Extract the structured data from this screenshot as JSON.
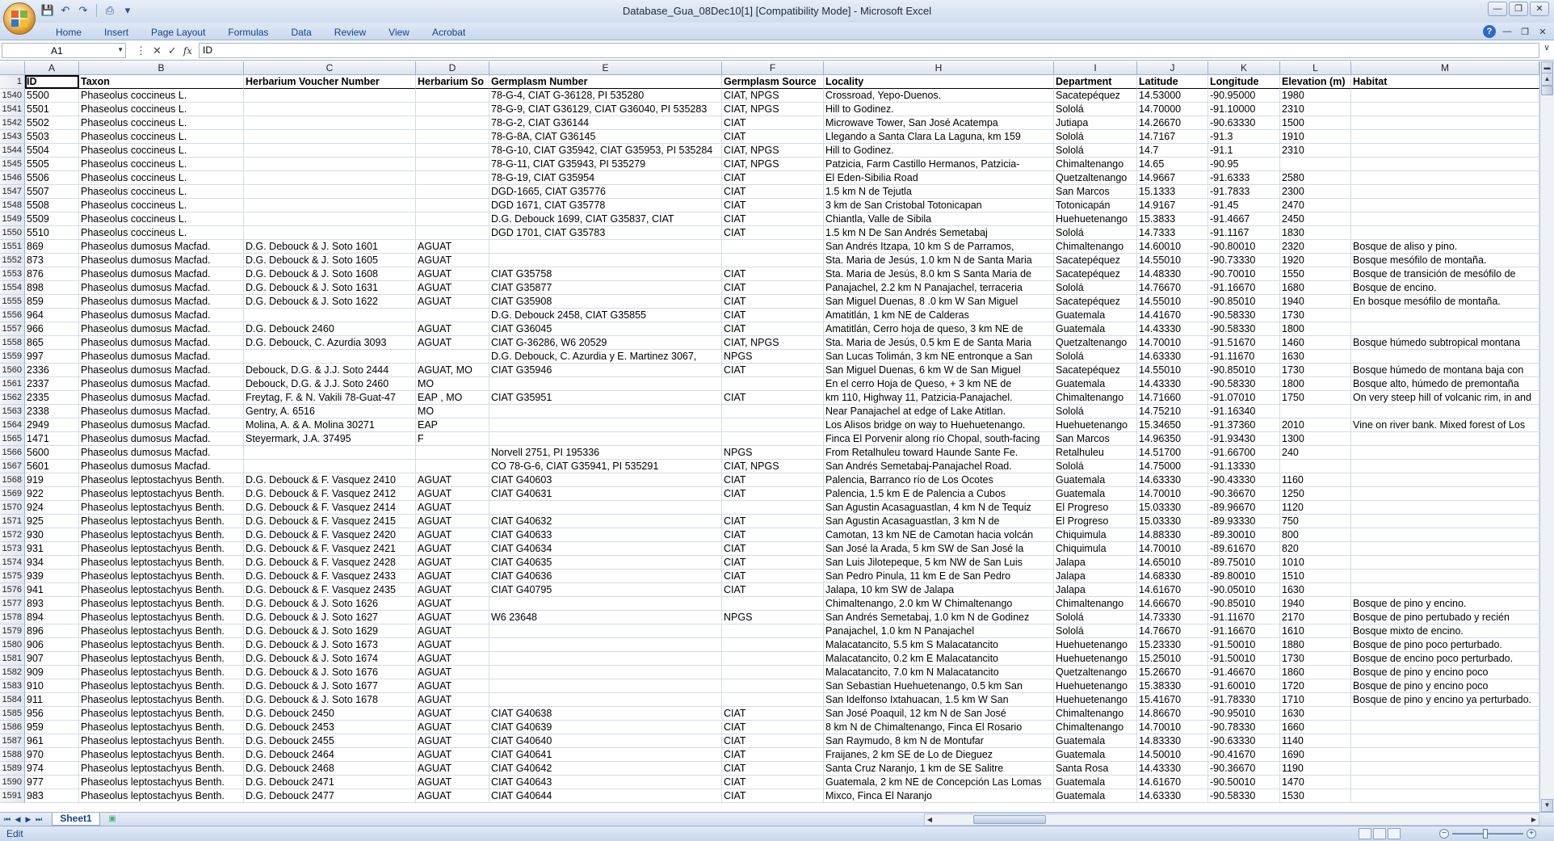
{
  "window": {
    "title": "Database_Gua_08Dec10[1]  [Compatibility Mode] - Microsoft Excel"
  },
  "ribbon": {
    "tabs": [
      "Home",
      "Insert",
      "Page Layout",
      "Formulas",
      "Data",
      "Review",
      "View",
      "Acrobat"
    ]
  },
  "formula_bar": {
    "name_box": "A1",
    "formula": "ID"
  },
  "columns": [
    {
      "letter": "A",
      "w": 67
    },
    {
      "letter": "B",
      "w": 204
    },
    {
      "letter": "C",
      "w": 213
    },
    {
      "letter": "D",
      "w": 91
    },
    {
      "letter": "E",
      "w": 288
    },
    {
      "letter": "F",
      "w": 126
    },
    {
      "letter": "H",
      "w": 285
    },
    {
      "letter": "I",
      "w": 103
    },
    {
      "letter": "J",
      "w": 88
    },
    {
      "letter": "K",
      "w": 89
    },
    {
      "letter": "L",
      "w": 88
    },
    {
      "letter": "M",
      "w": 233
    }
  ],
  "header_row": {
    "row_num": "1",
    "cells": [
      "ID",
      "Taxon",
      "Herbarium Voucher Number",
      "Herbarium So",
      "Germplasm Number",
      "Germplasm Source",
      "Locality",
      "Department",
      "Latitude",
      "Longitude",
      "Elevation (m)",
      "Habitat"
    ]
  },
  "rows": [
    [
      "1540",
      "5500",
      "Phaseolus coccineus L.",
      "",
      "",
      "78-G-4, CIAT G-36128, PI 535280",
      "CIAT, NPGS",
      "Crossroad, Yepo-Duenos.",
      "Sacatepéquez",
      "14.53000",
      "-90.95000",
      "1980",
      ""
    ],
    [
      "1541",
      "5501",
      "Phaseolus coccineus L.",
      "",
      "",
      "78-G-9, CIAT G36129, CIAT G36040, PI 535283",
      "CIAT, NPGS",
      "Hill to Godinez.",
      "Sololá",
      "14.70000",
      "-91.10000",
      "2310",
      ""
    ],
    [
      "1542",
      "5502",
      "Phaseolus coccineus L.",
      "",
      "",
      "78-G-2, CIAT G36144",
      "CIAT",
      "Microwave Tower, San José Acatempa",
      "Jutiapa",
      "14.26670",
      "-90.63330",
      "1500",
      ""
    ],
    [
      "1543",
      "5503",
      "Phaseolus coccineus L.",
      "",
      "",
      "78-G-8A, CIAT G36145",
      "CIAT",
      "Llegando a Santa Clara La Laguna, km 159",
      "Sololá",
      "14.7167",
      "-91.3",
      "1910",
      ""
    ],
    [
      "1544",
      "5504",
      "Phaseolus coccineus L.",
      "",
      "",
      "78-G-10, CIAT G35942, CIAT G35953, PI 535284",
      "CIAT, NPGS",
      "Hill to Godinez.",
      "Sololá",
      "14.7",
      "-91.1",
      "2310",
      ""
    ],
    [
      "1545",
      "5505",
      "Phaseolus coccineus L.",
      "",
      "",
      "78-G-11, CIAT G35943, PI 535279",
      "CIAT, NPGS",
      "Patzicia, Farm Castillo Hermanos, Patzicia-",
      "Chimaltenango",
      "14.65",
      "-90.95",
      "",
      ""
    ],
    [
      "1546",
      "5506",
      "Phaseolus coccineus L.",
      "",
      "",
      "78-G-19, CIAT G35954",
      "CIAT",
      "El Eden-Sibilia Road",
      "Quetzaltenango",
      "14.9667",
      "-91.6333",
      "2580",
      ""
    ],
    [
      "1547",
      "5507",
      "Phaseolus coccineus L.",
      "",
      "",
      "DGD-1665, CIAT G35776",
      "CIAT",
      "1.5 km N de Tejutla",
      "San Marcos",
      "15.1333",
      "-91.7833",
      "2300",
      ""
    ],
    [
      "1548",
      "5508",
      "Phaseolus coccineus L.",
      "",
      "",
      "DGD 1671, CIAT G35778",
      "CIAT",
      "3 km de San Cristobal Totonicapan",
      "Totonicapán",
      "14.9167",
      "-91.45",
      "2470",
      ""
    ],
    [
      "1549",
      "5509",
      "Phaseolus coccineus L.",
      "",
      "",
      "D.G. Debouck 1699, CIAT G35837, CIAT",
      "CIAT",
      "Chiantla, Valle de Sibila",
      "Huehuetenango",
      "15.3833",
      "-91.4667",
      "2450",
      ""
    ],
    [
      "1550",
      "5510",
      "Phaseolus coccineus L.",
      "",
      "",
      "DGD 1701, CIAT G35783",
      "CIAT",
      "1.5 km N De San Andrés Semetabaj",
      "Sololá",
      "14.7333",
      "-91.1167",
      "1830",
      ""
    ],
    [
      "1551",
      "869",
      "Phaseolus dumosus Macfad.",
      "D.G. Debouck & J. Soto 1601",
      "AGUAT",
      "",
      "",
      "San Andrés Itzapa, 10 km S de Parramos,",
      "Chimaltenango",
      "14.60010",
      "-90.80010",
      "2320",
      "Bosque de aliso y pino."
    ],
    [
      "1552",
      "873",
      "Phaseolus dumosus Macfad.",
      "D.G. Debouck & J. Soto 1605",
      "AGUAT",
      "",
      "",
      "Sta. Maria de Jesús, 1.0 km N de Santa Maria",
      "Sacatepéquez",
      "14.55010",
      "-90.73330",
      "1920",
      "Bosque mesófilo de montaña."
    ],
    [
      "1553",
      "876",
      "Phaseolus dumosus Macfad.",
      "D.G. Debouck & J. Soto 1608",
      "AGUAT",
      "CIAT G35758",
      "CIAT",
      "Sta. Maria de Jesús, 8.0 km S Santa Maria de",
      "Sacatepéquez",
      "14.48330",
      "-90.70010",
      "1550",
      "Bosque de transición de mesófilo de"
    ],
    [
      "1554",
      "898",
      "Phaseolus dumosus Macfad.",
      "D.G. Debouck & J. Soto 1631",
      "AGUAT",
      "CIAT G35877",
      "CIAT",
      "Panajachel, 2.2 km N Panajachel, terraceria",
      "Sololá",
      "14.76670",
      "-91.16670",
      "1680",
      "Bosque de encino."
    ],
    [
      "1555",
      "859",
      "Phaseolus dumosus Macfad.",
      "D.G. Debouck & J. Soto 1622",
      "AGUAT",
      "CIAT G35908",
      "CIAT",
      "San Miguel Duenas, 8 .0 km W San Miguel",
      "Sacatepéquez",
      "14.55010",
      "-90.85010",
      "1940",
      "En bosque mesófilo de montaña."
    ],
    [
      "1556",
      "964",
      "Phaseolus dumosus Macfad.",
      "",
      "",
      "D.G. Debouck 2458, CIAT G35855",
      "CIAT",
      "Amatitlán, 1 km NE de Calderas",
      "Guatemala",
      "14.41670",
      "-90.58330",
      "1730",
      ""
    ],
    [
      "1557",
      "966",
      "Phaseolus dumosus Macfad.",
      "D.G. Debouck 2460",
      "AGUAT",
      "CIAT G36045",
      "CIAT",
      "Amatitlán, Cerro hoja de queso, 3 km NE de",
      "Guatemala",
      "14.43330",
      "-90.58330",
      "1800",
      ""
    ],
    [
      "1558",
      "865",
      "Phaseolus dumosus Macfad.",
      "D.G. Debouck, C. Azurdia 3093",
      "AGUAT",
      "CIAT G-36286, W6 20529",
      "CIAT, NPGS",
      "Sta. Maria de Jesús, 0.5 km E de Santa Maria",
      "Quetzaltenango",
      "14.70010",
      "-91.51670",
      "1460",
      "Bosque húmedo subtropical montana"
    ],
    [
      "1559",
      "997",
      "Phaseolus dumosus Macfad.",
      "",
      "",
      "D.G. Debouck, C. Azurdia y E. Martinez 3067,",
      "NPGS",
      "San Lucas Tolimán, 3 km NE entronque a San",
      "Sololá",
      "14.63330",
      "-91.11670",
      "1630",
      ""
    ],
    [
      "1560",
      "2336",
      "Phaseolus dumosus Macfad.",
      "Debouck, D.G. & J.J. Soto  2444",
      "AGUAT, MO",
      "CIAT G35946",
      "CIAT",
      "San Miguel Duenas, 6 km W de San Miguel",
      "Sacatepéquez",
      "14.55010",
      "-90.85010",
      "1730",
      "Bosque húmedo de montana baja con"
    ],
    [
      "1561",
      "2337",
      "Phaseolus dumosus Macfad.",
      "Debouck, D.G. & J.J. Soto  2460",
      "MO",
      "",
      "",
      "En el cerro Hoja de Queso, + 3 km NE de",
      "Guatemala",
      "14.43330",
      "-90.58330",
      "1800",
      "Bosque alto, húmedo de premontaña"
    ],
    [
      "1562",
      "2335",
      "Phaseolus dumosus Macfad.",
      "Freytag, F. & N. Vakili 78-Guat-47",
      "EAP , MO",
      "CIAT G35951",
      "CIAT",
      "km 110, Highway 11, Patzicia-Panajachel.",
      "Chimaltenango",
      "14.71660",
      "-91.07010",
      "1750",
      "On very steep  hill of volcanic rim, in and"
    ],
    [
      "1563",
      "2338",
      "Phaseolus dumosus Macfad.",
      "Gentry, A.  6516",
      "MO",
      "",
      "",
      "Near Panajachel at edge of Lake Atitlan.",
      "Sololá",
      "14.75210",
      "-91.16340",
      "",
      ""
    ],
    [
      "1564",
      "2949",
      "Phaseolus dumosus Macfad.",
      "Molina, A. & A. Molina  30271",
      "EAP",
      "",
      "",
      "Los Alisos bridge on way to Huehuetenango.",
      "Huehuetenango",
      "15.34650",
      "-91.37360",
      "2010",
      "Vine on river bank. Mixed forest of Los"
    ],
    [
      "1565",
      "1471",
      "Phaseolus dumosus Macfad.",
      "Steyermark, J.A.  37495",
      "F",
      "",
      "",
      "Finca El Porvenir along río Chopal, south-facing",
      "San Marcos",
      "14.96350",
      "-91.93430",
      "1300",
      ""
    ],
    [
      "1566",
      "5600",
      "Phaseolus dumosus Macfad.",
      "",
      "",
      "Norvell 2751, PI 195336",
      "NPGS",
      "From Retalhuleu toward Haunde Sante Fe.",
      "Retalhuleu",
      "14.51700",
      "-91.66700",
      "240",
      ""
    ],
    [
      "1567",
      "5601",
      "Phaseolus dumosus Macfad.",
      "",
      "",
      "CO 78-G-6, CIAT G35941, PI 535291",
      "CIAT, NPGS",
      "San Andrés Semetabaj-Panajachel Road.",
      "Sololá",
      "14.75000",
      "-91.13330",
      "",
      ""
    ],
    [
      "1568",
      "919",
      "Phaseolus leptostachyus Benth.",
      "D.G. Debouck & F. Vasquez 2410",
      "AGUAT",
      "CIAT G40603",
      "CIAT",
      "Palencia, Barranco río de Los Ocotes",
      "Guatemala",
      "14.63330",
      "-90.43330",
      "1160",
      ""
    ],
    [
      "1569",
      "922",
      "Phaseolus leptostachyus Benth.",
      "D.G. Debouck & F. Vasquez 2412",
      "AGUAT",
      "CIAT G40631",
      "CIAT",
      "Palencia, 1.5 km E de Palencia a Cubos",
      "Guatemala",
      "14.70010",
      "-90.36670",
      "1250",
      ""
    ],
    [
      "1570",
      "924",
      "Phaseolus leptostachyus Benth.",
      "D.G. Debouck & F. Vasquez 2414",
      "AGUAT",
      "",
      "",
      "San Agustin Acasaguastlan, 4 km N de Tequiz",
      "El Progreso",
      "15.03330",
      "-89.96670",
      "1120",
      ""
    ],
    [
      "1571",
      "925",
      "Phaseolus leptostachyus Benth.",
      "D.G. Debouck & F. Vasquez 2415",
      "AGUAT",
      "CIAT G40632",
      "CIAT",
      "San Agustin Acasaguastlan, 3 km N de",
      "El Progreso",
      "15.03330",
      "-89.93330",
      "750",
      ""
    ],
    [
      "1572",
      "930",
      "Phaseolus leptostachyus Benth.",
      "D.G. Debouck & F. Vasquez 2420",
      "AGUAT",
      "CIAT G40633",
      "CIAT",
      "Camotan, 13 km NE de Camotan hacia volcán",
      "Chiquimula",
      "14.88330",
      "-89.30010",
      "800",
      ""
    ],
    [
      "1573",
      "931",
      "Phaseolus leptostachyus Benth.",
      "D.G. Debouck & F. Vasquez 2421",
      "AGUAT",
      "CIAT G40634",
      "CIAT",
      "San José la Arada, 5 km SW de San José la",
      "Chiquimula",
      "14.70010",
      "-89.61670",
      "820",
      ""
    ],
    [
      "1574",
      "934",
      "Phaseolus leptostachyus Benth.",
      "D.G. Debouck & F. Vasquez 2428",
      "AGUAT",
      "CIAT G40635",
      "CIAT",
      "San Luis Jilotepeque, 5 km NW de San Luis",
      "Jalapa",
      "14.65010",
      "-89.75010",
      "1010",
      ""
    ],
    [
      "1575",
      "939",
      "Phaseolus leptostachyus Benth.",
      "D.G. Debouck & F. Vasquez 2433",
      "AGUAT",
      "CIAT G40636",
      "CIAT",
      "San Pedro Pinula, 11 km E de San Pedro",
      "Jalapa",
      "14.68330",
      "-89.80010",
      "1510",
      ""
    ],
    [
      "1576",
      "941",
      "Phaseolus leptostachyus Benth.",
      "D.G. Debouck & F. Vasquez 2435",
      "AGUAT",
      "CIAT G40795",
      "CIAT",
      "Jalapa, 10 km SW de Jalapa",
      "Jalapa",
      "14.61670",
      "-90.05010",
      "1630",
      ""
    ],
    [
      "1577",
      "893",
      "Phaseolus leptostachyus Benth.",
      "D.G. Debouck & J. Soto 1626",
      "AGUAT",
      "",
      "",
      "Chimaltenango, 2.0 km W Chimaltenango",
      "Chimaltenango",
      "14.66670",
      "-90.85010",
      "1940",
      "Bosque de pino y encino."
    ],
    [
      "1578",
      "894",
      "Phaseolus leptostachyus Benth.",
      "D.G. Debouck & J. Soto 1627",
      "AGUAT",
      "W6 23648",
      "NPGS",
      "San Andrés Semetabaj, 1.0 km N de Godinez",
      "Sololá",
      "14.73330",
      "-91.11670",
      "2170",
      "Bosque de pino pertubado y recién"
    ],
    [
      "1579",
      "896",
      "Phaseolus leptostachyus Benth.",
      "D.G. Debouck & J. Soto 1629",
      "AGUAT",
      "",
      "",
      "Panajachel, 1.0 km N Panajachel",
      "Sololá",
      "14.76670",
      "-91.16670",
      "1610",
      "Bosque mixto de encino."
    ],
    [
      "1580",
      "906",
      "Phaseolus leptostachyus Benth.",
      "D.G. Debouck & J. Soto 1673",
      "AGUAT",
      "",
      "",
      "Malacatancito, 5.5 km S Malacatancito",
      "Huehuetenango",
      "15.23330",
      "-91.50010",
      "1880",
      "Bosque de pino poco perturbado."
    ],
    [
      "1581",
      "907",
      "Phaseolus leptostachyus Benth.",
      "D.G. Debouck & J. Soto 1674",
      "AGUAT",
      "",
      "",
      "Malacatancito, 0.2 km E Malacatancito",
      "Huehuetenango",
      "15.25010",
      "-91.50010",
      "1730",
      "Bosque de encino poco perturbado."
    ],
    [
      "1582",
      "909",
      "Phaseolus leptostachyus Benth.",
      "D.G. Debouck & J. Soto 1676",
      "AGUAT",
      "",
      "",
      "Malacatancito, 7.0 km N Malacatancito",
      "Quetzaltenango",
      "15.26670",
      "-91.46670",
      "1860",
      "Bosque de pino y encino poco"
    ],
    [
      "1583",
      "910",
      "Phaseolus leptostachyus Benth.",
      "D.G. Debouck & J. Soto 1677",
      "AGUAT",
      "",
      "",
      "San Sebastian Huehuetenango, 0.5 km San",
      "Huehuetenango",
      "15.38330",
      "-91.60010",
      "1720",
      "Bosque de pino y encino poco"
    ],
    [
      "1584",
      "911",
      "Phaseolus leptostachyus Benth.",
      "D.G. Debouck & J. Soto 1678",
      "AGUAT",
      "",
      "",
      "San Idelfonso Ixtahuacan, 1.5 km W San",
      "Huehuetenango",
      "15.41670",
      "-91.78330",
      "1710",
      "Bosque de pino y encino ya perturbado."
    ],
    [
      "1585",
      "956",
      "Phaseolus leptostachyus Benth.",
      "D.G. Debouck 2450",
      "AGUAT",
      "CIAT G40638",
      "CIAT",
      "San José Poaquil, 12 km N de San José",
      "Chimaltenango",
      "14.86670",
      "-90.95010",
      "1630",
      ""
    ],
    [
      "1586",
      "959",
      "Phaseolus leptostachyus Benth.",
      "D.G. Debouck 2453",
      "AGUAT",
      "CIAT G40639",
      "CIAT",
      "8 km N de Chimaltenango, Finca El Rosario",
      "Chimaltenango",
      "14.70010",
      "-90.78330",
      "1660",
      ""
    ],
    [
      "1587",
      "961",
      "Phaseolus leptostachyus Benth.",
      "D.G. Debouck 2455",
      "AGUAT",
      "CIAT G40640",
      "CIAT",
      "San Raymudo, 8 km N de Montufar",
      "Guatemala",
      "14.83330",
      "-90.63330",
      "1140",
      ""
    ],
    [
      "1588",
      "970",
      "Phaseolus leptostachyus Benth.",
      "D.G. Debouck 2464",
      "AGUAT",
      "CIAT G40641",
      "CIAT",
      "Fraijanes, 2 km SE de Lo de Dieguez",
      "Guatemala",
      "14.50010",
      "-90.41670",
      "1690",
      ""
    ],
    [
      "1589",
      "974",
      "Phaseolus leptostachyus Benth.",
      "D.G. Debouck 2468",
      "AGUAT",
      "CIAT G40642",
      "CIAT",
      "Santa Cruz Naranjo, 1 km de SE Salitre",
      "Santa Rosa",
      "14.43330",
      "-90.36670",
      "1190",
      ""
    ],
    [
      "1590",
      "977",
      "Phaseolus leptostachyus Benth.",
      "D.G. Debouck 2471",
      "AGUAT",
      "CIAT G40643",
      "CIAT",
      "Guatemala, 2 km NE de Concepción Las Lomas",
      "Guatemala",
      "14.61670",
      "-90.50010",
      "1470",
      ""
    ],
    [
      "1591",
      "983",
      "Phaseolus leptostachyus Benth.",
      "D.G. Debouck 2477",
      "AGUAT",
      "CIAT G40644",
      "CIAT",
      "Mixco, Finca El Naranjo",
      "Guatemala",
      "14.63330",
      "-90.58330",
      "1530",
      ""
    ]
  ],
  "sheets": [
    "Sheet1"
  ],
  "status": {
    "mode": "Edit"
  }
}
